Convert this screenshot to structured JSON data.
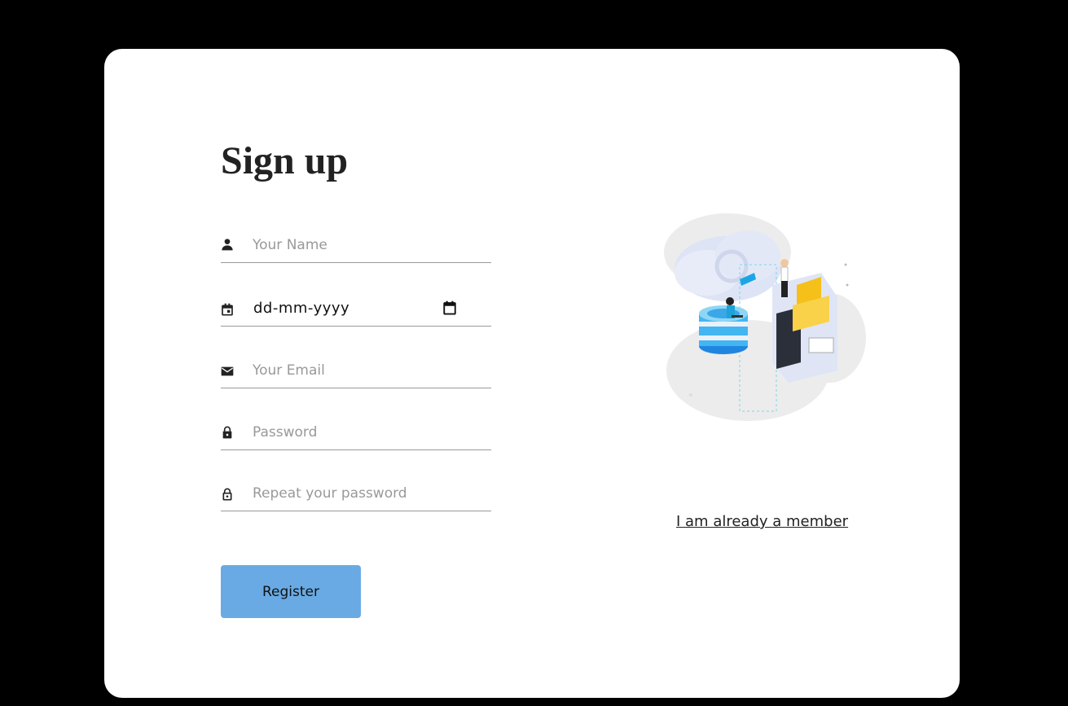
{
  "form": {
    "title": "Sign up",
    "name_placeholder": "Your Name",
    "date_text": "dd-mm-yyyy",
    "email_placeholder": "Your Email",
    "password_placeholder": "Password",
    "repeat_password_placeholder": "Repeat your password",
    "register_label": "Register"
  },
  "aside": {
    "member_link": "I am already a member",
    "illustration": "cloud-database-illustration"
  },
  "colors": {
    "background": "#000000",
    "card": "#ffffff",
    "button": "#6aaae4"
  },
  "icons": [
    "person-icon",
    "calendar-icon",
    "email-icon",
    "lock-icon",
    "lock-outline-icon",
    "calendar-picker-icon"
  ]
}
